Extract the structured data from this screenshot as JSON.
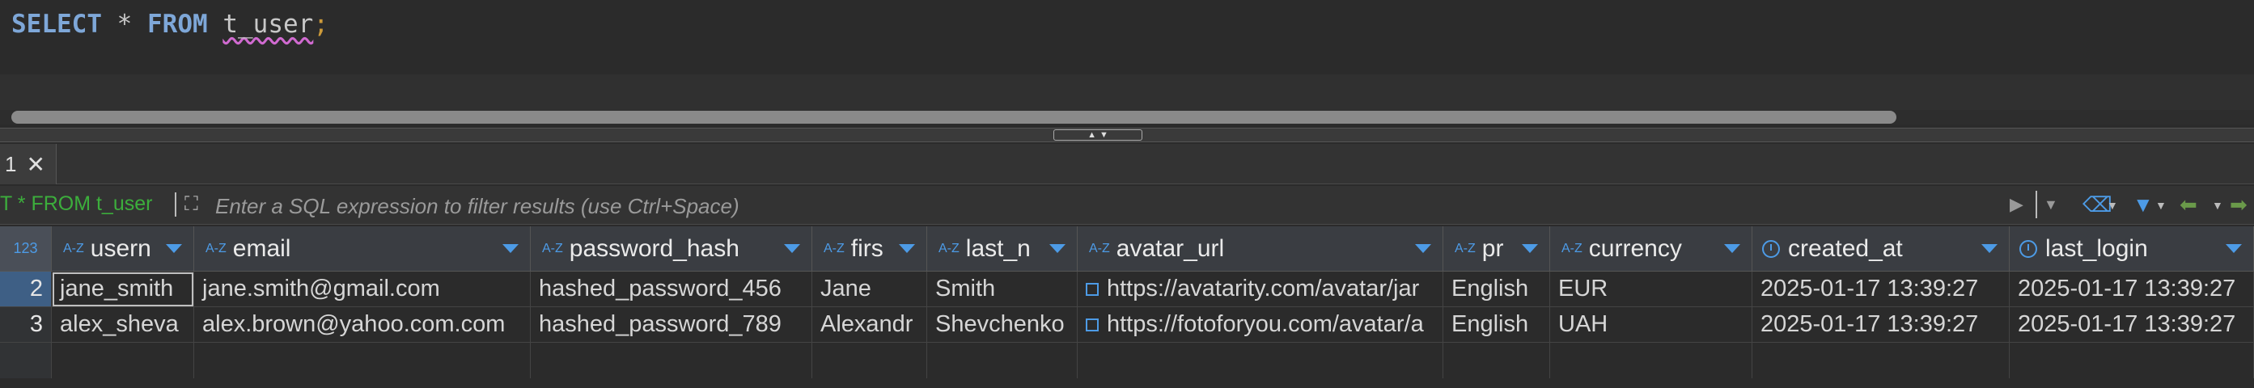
{
  "editor": {
    "kw_select": "SELECT",
    "op_star": "*",
    "kw_from": "FROM",
    "table": "t_user",
    "semicolon": ";"
  },
  "results_tab": {
    "label": "1"
  },
  "filter": {
    "query_label": "T * FROM t_user",
    "placeholder": "Enter a SQL expression to filter results (use Ctrl+Space)"
  },
  "columns": [
    {
      "label": "usern",
      "type": "text"
    },
    {
      "label": "email",
      "type": "text"
    },
    {
      "label": "password_hash",
      "type": "text"
    },
    {
      "label": "firs",
      "type": "text"
    },
    {
      "label": "last_n",
      "type": "text"
    },
    {
      "label": "avatar_url",
      "type": "text"
    },
    {
      "label": "pr",
      "type": "text"
    },
    {
      "label": "currency",
      "type": "text"
    },
    {
      "label": "created_at",
      "type": "datetime"
    },
    {
      "label": "last_login",
      "type": "datetime"
    }
  ],
  "rownum_header": "123",
  "rows": [
    {
      "num": "2",
      "cells": [
        "jane_smith",
        "jane.smith@gmail.com",
        "hashed_password_456",
        "Jane",
        "Smith",
        "https://avatarity.com/avatar/jar",
        "English",
        "EUR",
        "2025-01-17 13:39:27",
        "2025-01-17 13:39:27"
      ]
    },
    {
      "num": "3",
      "cells": [
        "alex_sheva",
        "alex.brown@yahoo.com.com",
        "hashed_password_789",
        "Alexandr",
        "Shevchenko",
        "https://fotoforyou.com/avatar/a",
        "English",
        "UAH",
        "2025-01-17 13:39:27",
        "2025-01-17 13:39:27"
      ]
    }
  ],
  "colors": {
    "accent": "#4d9be6",
    "keyword": "#7ea7d8",
    "filter_sql": "#3cae3c"
  }
}
